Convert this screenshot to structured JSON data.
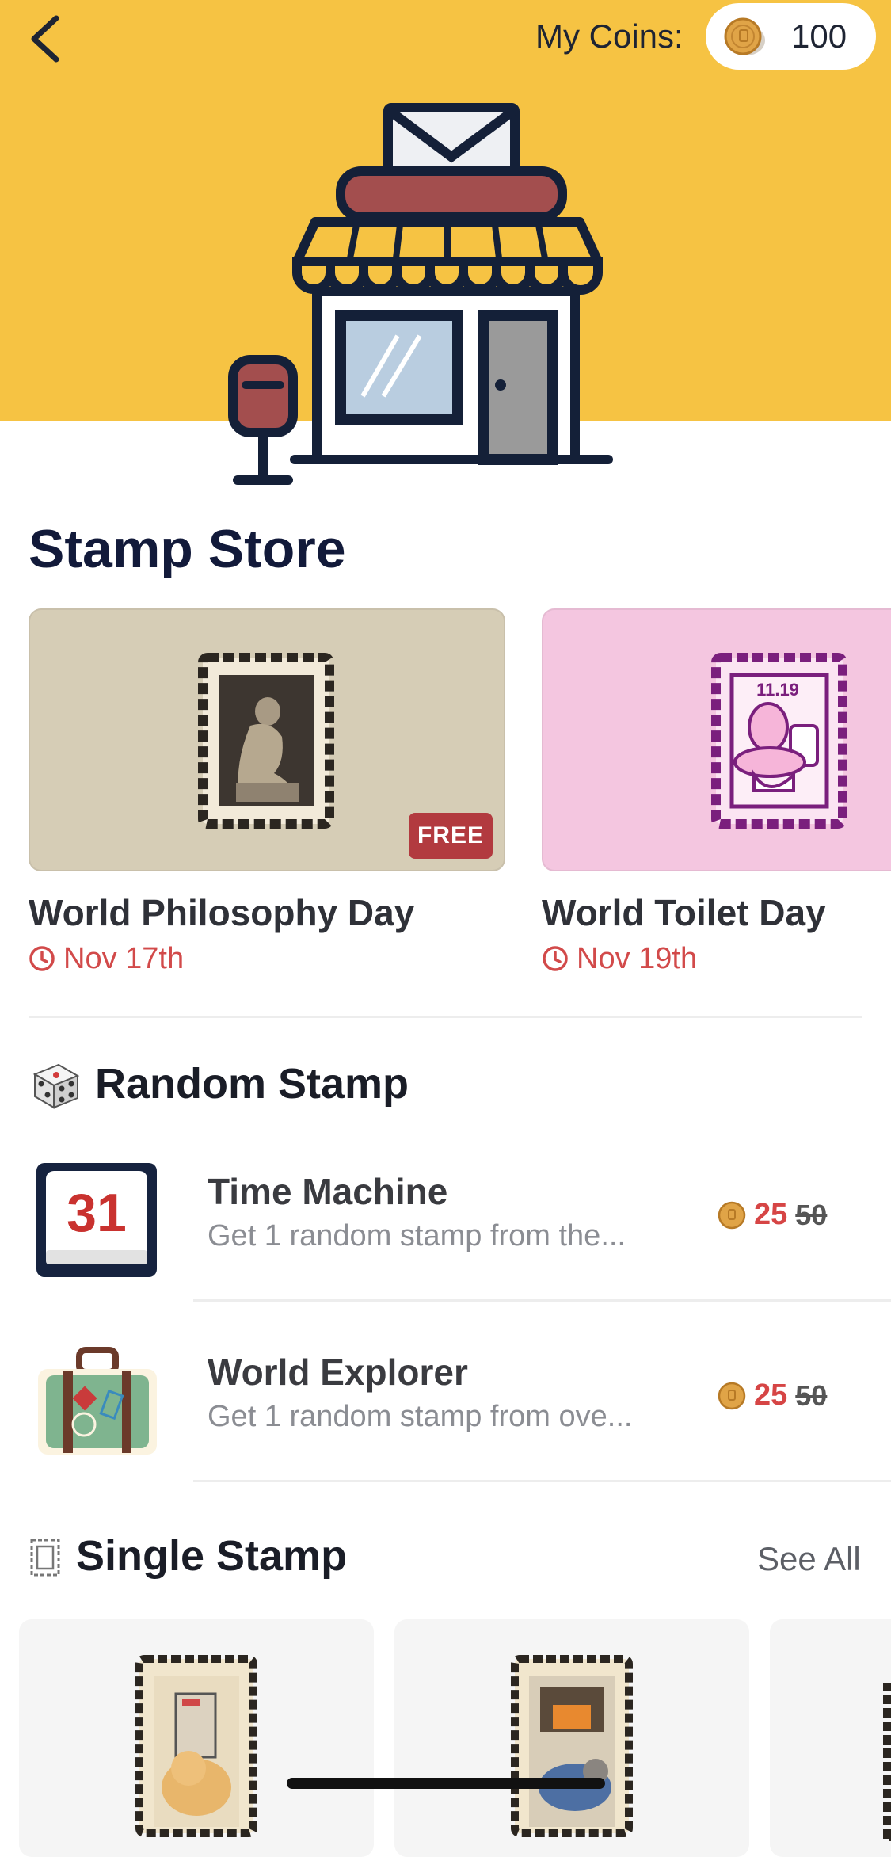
{
  "header": {
    "coins_label": "My Coins:",
    "coins_value": "100"
  },
  "store": {
    "title": "Stamp Store"
  },
  "featured": [
    {
      "title": "World Philosophy Day",
      "date": "Nov 17th",
      "badge": "FREE"
    },
    {
      "title": "World Toilet Day",
      "date": "Nov 19th",
      "stamp_text": "11.19"
    }
  ],
  "random_stamp": {
    "title": "Random Stamp",
    "items": [
      {
        "title": "Time Machine",
        "subtitle": "Get 1 random stamp from the...",
        "price": "25",
        "old_price": "50",
        "icon_text": "31"
      },
      {
        "title": "World Explorer",
        "subtitle": "Get 1 random stamp from ove...",
        "price": "25",
        "old_price": "50"
      }
    ]
  },
  "single_stamp": {
    "title": "Single Stamp",
    "see_all": "See All"
  },
  "colors": {
    "hero_bg": "#f6c343",
    "accent_red": "#d64545",
    "badge_red": "#b23a3f",
    "title_navy": "#121a3a"
  }
}
